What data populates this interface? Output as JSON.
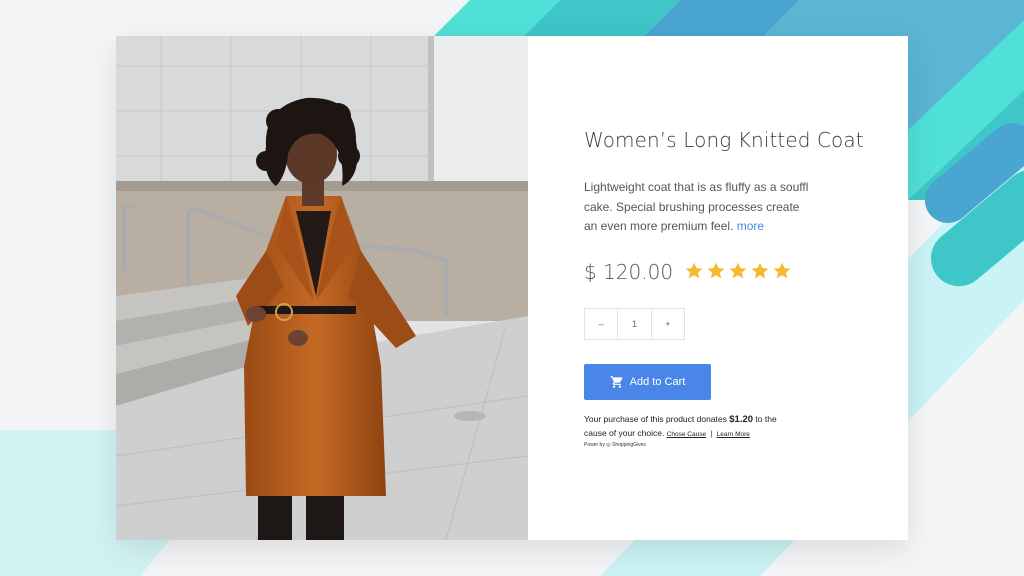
{
  "product": {
    "title": "Women’s Long Knitted Coat",
    "description": "Lightweight coat that is as fluffy as a souffl cake. Special brushing processes create an even more premium feel.",
    "more_label": "more",
    "price": "$ 120.00",
    "rating": 5,
    "rating_max": 5
  },
  "quantity": {
    "minus_label": "–",
    "value": "1",
    "plus_label": "+"
  },
  "cart": {
    "label": "Add to Cart",
    "icon": "shopping-cart-icon"
  },
  "donation": {
    "text_before": "Your purchase of this product donates",
    "amount": "$1.20",
    "text_after": "to the cause of your choice.",
    "choose_cause_label": "Chose Cause",
    "separator": "|",
    "learn_more_label": "Learn More",
    "powered_by": "Power by ◎ ShoppingGives"
  },
  "colors": {
    "accent": "#4a86e8",
    "star": "#f5b82e",
    "teal": "#4fe0d8",
    "blue": "#4aa6d0"
  },
  "image": {
    "subject": "photo of woman wearing long rust-colored coat"
  }
}
